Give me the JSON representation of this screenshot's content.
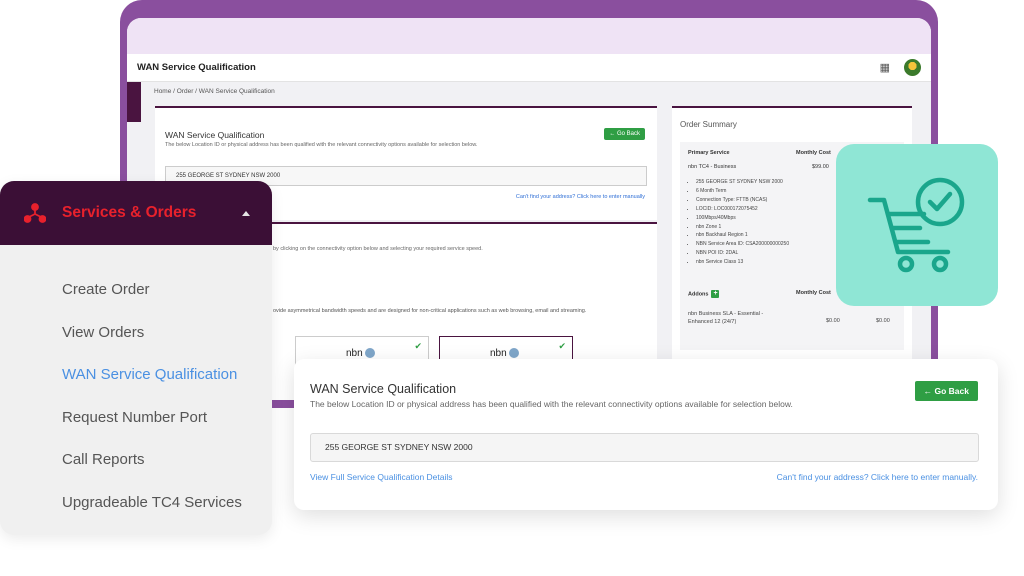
{
  "app": {
    "title": "WAN Service Qualification",
    "breadcrumb": "Home  /  Order  /  WAN Service Qualification"
  },
  "bg_main": {
    "title": "WAN Service Qualification",
    "subtitle": "The below Location ID or physical address has been qualified with the relevant connectivity options available for selection below.",
    "back_label": "← Go Back",
    "address": "255 GEORGE ST  SYDNEY NSW 2000",
    "cant_find": "Can't find your address? Click here to enter manually",
    "connectivity_hint": "by clicking on the connectivity option below and selecting your required service speed.",
    "product_text": "ovide asymmetrical bandwidth speeds and are designed for non-critical applications such as web browsing, email and streaming.",
    "nbn_label": "nbn"
  },
  "order_summary": {
    "title": "Order Summary",
    "primary_service_label": "Primary Service",
    "monthly_cost_label": "Monthly Cost",
    "product": "nbn TC4 - Business",
    "price": "$99.00",
    "details": [
      "255 GEORGE ST SYDNEY NSW 2000",
      "6 Month Term",
      "Connection Type: FTTB (NCAS)",
      "LOCID: LOC000172075452",
      "100Mbps/40Mbps",
      "nbn Zone 1",
      "nbn Backhaul Region 1",
      "NBN Service Area ID: CSA200000000250",
      "NBN POI ID: 2DAL",
      "nbn Service Class 13"
    ],
    "addons_label": "Addons",
    "addons_plus": "+",
    "addons_cost_label": "Monthly Cost",
    "addon_name": "nbn Business SLA - Essential - Enhanced 12 (24/7)",
    "addon_price_1": "$0.00",
    "addon_price_2": "$0.00"
  },
  "sidebar": {
    "title": "Services & Orders",
    "items": [
      {
        "label": "Create Order"
      },
      {
        "label": "View Orders"
      },
      {
        "label": "WAN Service Qualification"
      },
      {
        "label": "Request Number Port"
      },
      {
        "label": "Call Reports"
      },
      {
        "label": "Upgradeable TC4 Services"
      }
    ]
  },
  "front_card": {
    "title": "WAN Service Qualification",
    "subtitle": "The below Location ID or physical address has been qualified with the relevant connectivity options available for selection below.",
    "back_label": "← Go Back",
    "address": "255 GEORGE ST  SYDNEY NSW 2000",
    "view_details": "View Full Service Qualification Details",
    "cant_find": "Can't find your address? Click here to enter manually."
  },
  "colors": {
    "brand_purple": "#8a4f9e",
    "sidebar_header": "#3b0f36",
    "accent_red": "#e8212c",
    "green_button": "#2f9e44",
    "link_blue": "#4a90e2",
    "cart_tile": "#8fe6d5",
    "cart_icon": "#1aa68c"
  }
}
